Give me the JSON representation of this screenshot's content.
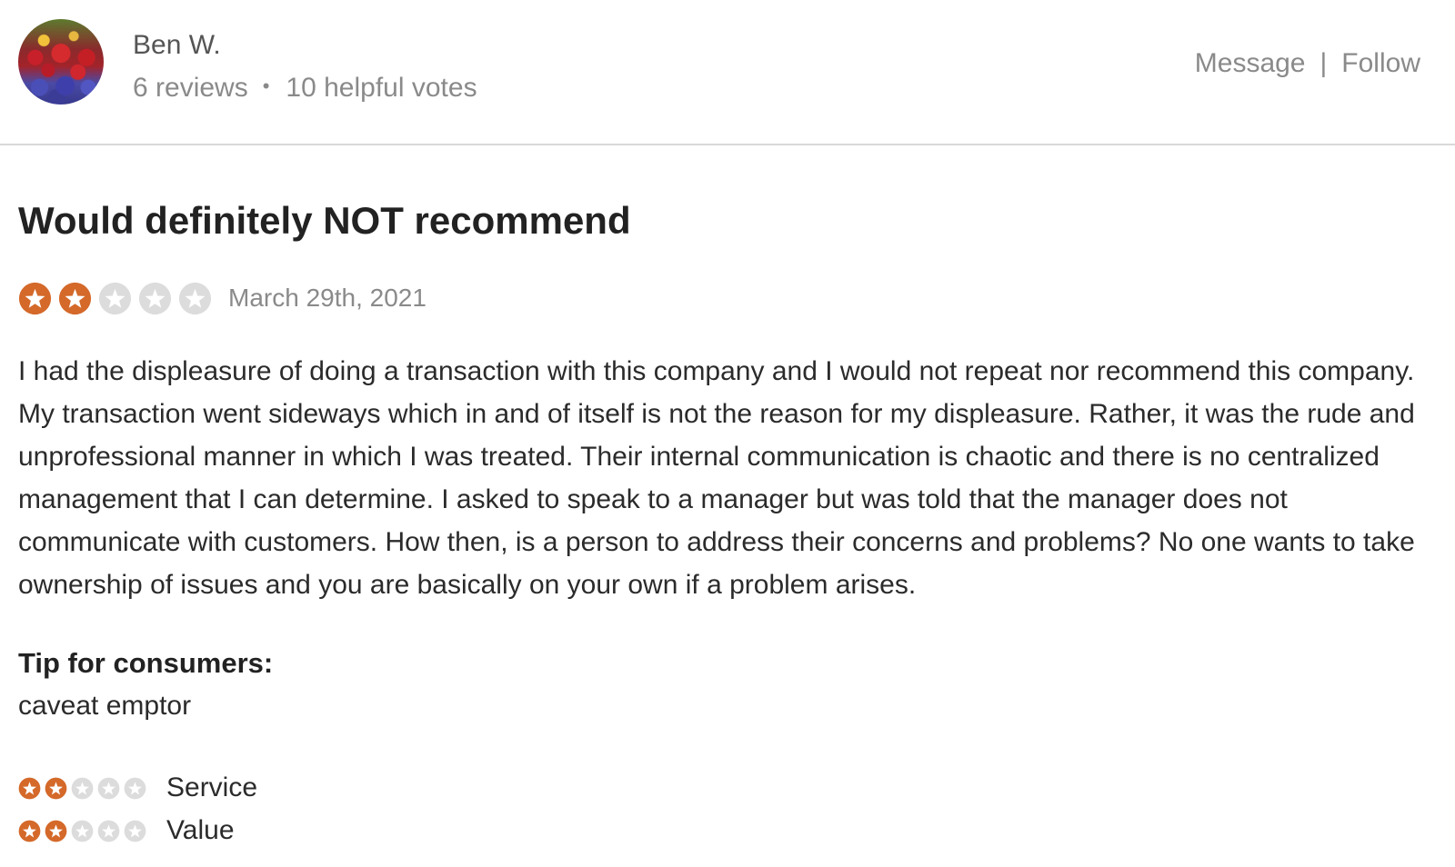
{
  "reviewer": {
    "name": "Ben W.",
    "reviews": "6 reviews",
    "helpful_votes": "10 helpful votes",
    "separator": "•"
  },
  "actions": {
    "message": "Message",
    "divider": "|",
    "follow": "Follow"
  },
  "review": {
    "title": "Would definitely NOT recommend",
    "rating": 2,
    "rating_max": 5,
    "date": "March 29th, 2021",
    "body": "I had the displeasure of doing a transaction with this company and I would not repeat nor recommend this company. My transaction went sideways which in and of itself is not the reason for my displeasure. Rather, it was the rude and unprofessional manner in which I was treated. Their internal communication is chaotic and there is no centralized management that I can determine. I asked to speak to a manager but was told that the manager does not communicate with customers. How then, is a person to address their concerns and problems? No one wants to take ownership of issues and you are basically on your own if a problem arises.",
    "tip_label": "Tip for consumers:",
    "tip_text": "caveat emptor"
  },
  "sub_ratings": [
    {
      "label": "Service",
      "rating": 2,
      "max": 5
    },
    {
      "label": "Value",
      "rating": 2,
      "max": 5
    }
  ],
  "colors": {
    "star_filled": "#d4692a",
    "star_empty": "#dcdcdc",
    "muted_text": "#8a8a8a"
  },
  "icons": {
    "avatar": "avatar-flowers-photo",
    "star": "star-icon"
  }
}
